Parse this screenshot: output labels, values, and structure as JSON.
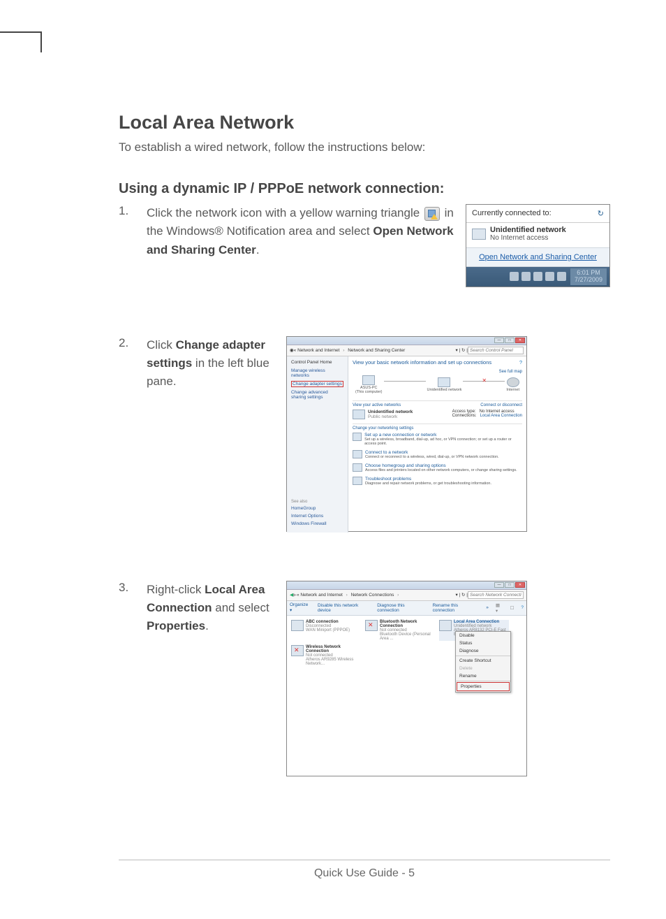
{
  "heading": "Local Area Network",
  "intro": "To establish a wired network, follow the instructions below:",
  "subheading": "Using a dynamic IP / PPPoE network connection:",
  "steps": {
    "s1": {
      "num": "1.",
      "t1": "Click the network icon with a yellow warning triangle ",
      "t2": " in the Windows® Notification area and select ",
      "bold": "Open Network and Sharing Center",
      "period": "."
    },
    "s2": {
      "num": "2.",
      "t1": "Click ",
      "bold": "Change adapter settings",
      "t2": " in the left blue pane."
    },
    "s3": {
      "num": "3.",
      "t1": "Right-click ",
      "bold1": "Local Area Connection",
      "t2": " and select ",
      "bold2": "Properties",
      "period": "."
    }
  },
  "shot1": {
    "connectedTo": "Currently connected to:",
    "refresh": "↻",
    "netTitle": "Unidentified network",
    "netSub": "No Internet access",
    "link": "Open Network and Sharing Center",
    "time": "6:01 PM",
    "date": "7/27/2009"
  },
  "shot2": {
    "breadcrumb1": "« Network and Internet",
    "breadcrumb2": "Network and Sharing Center",
    "searchPh": "Search Control Panel",
    "side": {
      "home": "Control Panel Home",
      "l1": "Manage wireless networks",
      "l2": "Change adapter settings",
      "l3": "Change advanced sharing settings",
      "seeAlso": "See also",
      "sa1": "HomeGroup",
      "sa2": "Internet Options",
      "sa3": "Windows Firewall"
    },
    "main": {
      "title": "View your basic network information and set up connections",
      "fullmap": "See full map",
      "n1a": "ASUS-PC",
      "n1b": "(This computer)",
      "n2": "Unidentified network",
      "n3": "Internet",
      "activeHdr": "View your active networks",
      "activeLink": "Connect or disconnect",
      "an1": "Unidentified network",
      "an2": "Public network",
      "at": "Access type:",
      "atv": "No Internet access",
      "cn": "Connections:",
      "cnv": "Local Area Connection",
      "chgHdr": "Change your networking settings",
      "o1h": "Set up a new connection or network",
      "o1d": "Set up a wireless, broadband, dial-up, ad hoc, or VPN connection; or set up a router or access point.",
      "o2h": "Connect to a network",
      "o2d": "Connect or reconnect to a wireless, wired, dial-up, or VPN network connection.",
      "o3h": "Choose homegroup and sharing options",
      "o3d": "Access files and printers located on other network computers, or change sharing settings.",
      "o4h": "Troubleshoot problems",
      "o4d": "Diagnose and repair network problems, or get troubleshooting information."
    }
  },
  "shot3": {
    "breadcrumb1": "« Network and Internet",
    "breadcrumb2": "Network Connections",
    "searchPh": "Search Network Connections",
    "toolbar": {
      "org": "Organize ▾",
      "t1": "Disable this network device",
      "t2": "Diagnose this connection",
      "t3": "Rename this connection",
      "more": "»"
    },
    "c1": {
      "n": "ABC connection",
      "s": "Disconnected",
      "d": "WAN Miniport (PPPOE)"
    },
    "c2": {
      "n": "Bluetooth Network Connection",
      "s": "Not connected",
      "d": "Bluetooth Device (Personal Area ..."
    },
    "c3": {
      "n": "Local Area Connection",
      "s": "Unidentified network",
      "d": "Atheros AR8132 PCI-E Fast Ethern..."
    },
    "c4": {
      "n": "Wireless Network Connection",
      "s": "Not connected",
      "d": "Atheros AR9285 Wireless Network..."
    },
    "menu": {
      "m1": "Disable",
      "m2": "Status",
      "m3": "Diagnose",
      "m4": "Create Shortcut",
      "m5": "Delete",
      "m6": "Rename",
      "m7": "Properties"
    }
  },
  "footer": "Quick Use Guide - 5"
}
